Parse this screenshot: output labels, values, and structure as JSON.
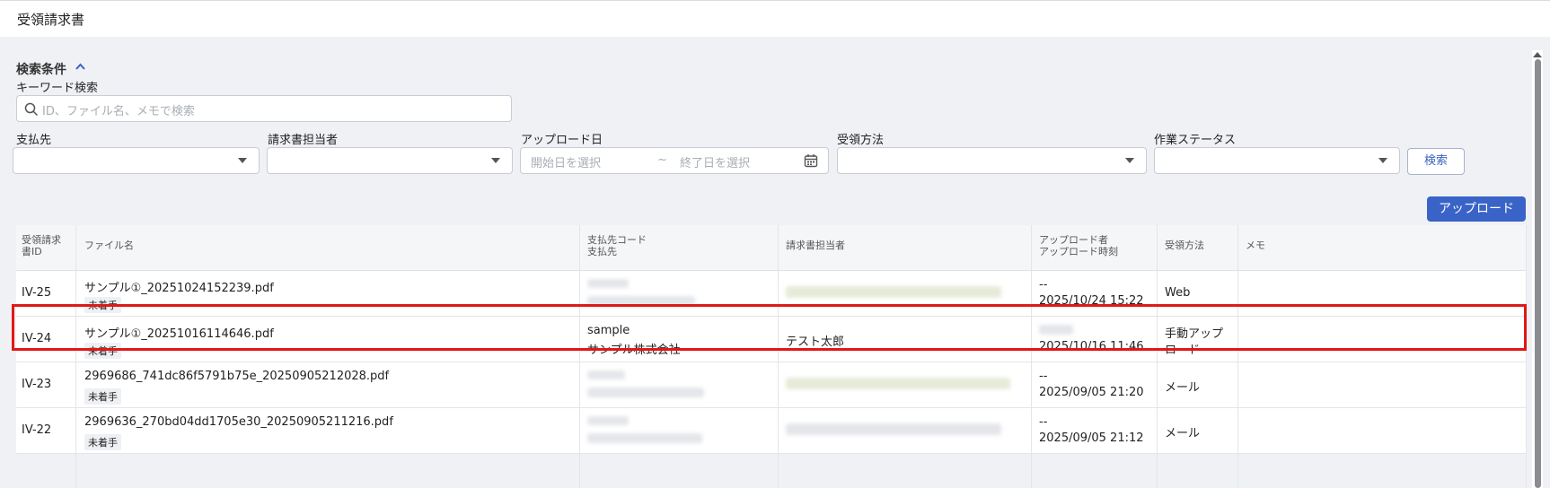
{
  "page": {
    "title": "受領請求書"
  },
  "search": {
    "section_title": "検索条件",
    "keyword_label": "キーワード検索",
    "keyword_placeholder": "ID、ファイル名、メモで検索",
    "payee_label": "支払先",
    "assignee_label": "請求書担当者",
    "upload_date_label": "アップロード日",
    "start_date_placeholder": "開始日を選択",
    "range_separator": "~",
    "end_date_placeholder": "終了日を選択",
    "receipt_method_label": "受領方法",
    "work_status_label": "作業ステータス",
    "search_button": "検索"
  },
  "upload_button": "アップロード",
  "table": {
    "columns": {
      "id": [
        "受領請求",
        "書ID"
      ],
      "filename": "ファイル名",
      "payee": [
        "支払先コード",
        "支払先"
      ],
      "assignee": "請求書担当者",
      "uploader": [
        "アップロード者",
        "アップロード時刻"
      ],
      "method": "受領方法",
      "memo": "メモ"
    },
    "rows": [
      {
        "id": "IV-25",
        "filename": "サンプル①_20251024152239.pdf",
        "status": "未着手",
        "payee_code": "",
        "payee_name": "",
        "assignee": "",
        "uploader": "--",
        "uploaded_at": "2025/10/24 15:22",
        "method": [
          "Web"
        ],
        "memo": ""
      },
      {
        "id": "IV-24",
        "filename": "サンプル①_20251016114646.pdf",
        "status": "未着手",
        "payee_code": "sample",
        "payee_name": "サンプル株式会社",
        "assignee": "テスト太郎",
        "uploader": "",
        "uploaded_at": "2025/10/16 11:46",
        "method": [
          "手動アップ",
          "ロード"
        ],
        "memo": ""
      },
      {
        "id": "IV-23",
        "filename": "2969686_741dc86f5791b75e_20250905212028.pdf",
        "status": "未着手",
        "payee_code": "",
        "payee_name": "",
        "assignee": "",
        "uploader": "--",
        "uploaded_at": "2025/09/05 21:20",
        "method": [
          "メール"
        ],
        "memo": ""
      },
      {
        "id": "IV-22",
        "filename": "2969636_270bd04dd1705e30_20250905211216.pdf",
        "status": "未着手",
        "payee_code": "",
        "payee_name": "",
        "assignee": "",
        "uploader": "--",
        "uploaded_at": "2025/09/05 21:12",
        "method": [
          "メール"
        ],
        "memo": ""
      }
    ]
  },
  "colors": {
    "accent": "#3a63c8",
    "highlight": "#e01818"
  }
}
